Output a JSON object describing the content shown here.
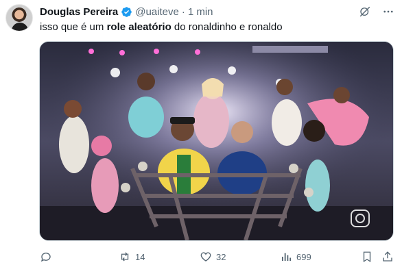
{
  "post": {
    "author": {
      "display_name": "Douglas Pereira",
      "handle": "@uaiteve",
      "time": "1 min",
      "verified": true
    },
    "text": {
      "prefix": "isso que é um ",
      "bold": "role aleatório",
      "suffix": " do ronaldinho e ronaldo"
    },
    "media": {
      "type": "video-still",
      "watermark_icon": "globoplay-logo-icon"
    },
    "actions": {
      "reply_count": "",
      "repost_count": "14",
      "like_count": "32",
      "views_count": "699"
    },
    "icons": {
      "verified": "verified-badge-icon",
      "grok": "grok-icon",
      "more": "more-icon",
      "reply": "reply-icon",
      "repost": "repost-icon",
      "like": "heart-icon",
      "views": "views-icon",
      "bookmark": "bookmark-icon",
      "share": "share-icon"
    },
    "colors": {
      "verified_blue": "#1d9bf0",
      "muted_text": "#536471",
      "primary_text": "#0f1419"
    }
  }
}
